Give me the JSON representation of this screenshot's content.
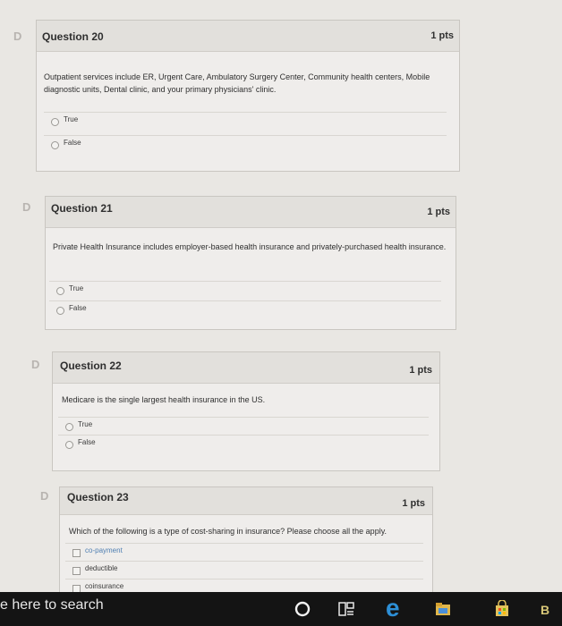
{
  "questions": [
    {
      "title": "Question 20",
      "points": "1 pts",
      "text": "Outpatient services include ER, Urgent Care, Ambulatory Surgery Center, Community health centers, Mobile diagnostic units, Dental clinic, and your primary physicians' clinic.",
      "answers": [
        "True",
        "False"
      ]
    },
    {
      "title": "Question 21",
      "points": "1 pts",
      "text": "Private Health Insurance includes employer-based health insurance and privately-purchased health insurance.",
      "answers": [
        "True",
        "False"
      ]
    },
    {
      "title": "Question 22",
      "points": "1 pts",
      "text": "Medicare is the single largest health insurance in the US.",
      "answers": [
        "True",
        "False"
      ]
    },
    {
      "title": "Question 23",
      "points": "1 pts",
      "text": "Which of the following is a type of cost-sharing in insurance? Please choose all the apply.",
      "answers": [
        "co-payment",
        "deductible",
        "coinsurance"
      ]
    }
  ],
  "taskbar": {
    "search_placeholder": "e here to search",
    "edge_letter": "e",
    "trailing_letter": "B"
  },
  "colors": {
    "taskbar": "#141414",
    "card": "#efedeb",
    "edge_blue": "#2d8fd6"
  }
}
